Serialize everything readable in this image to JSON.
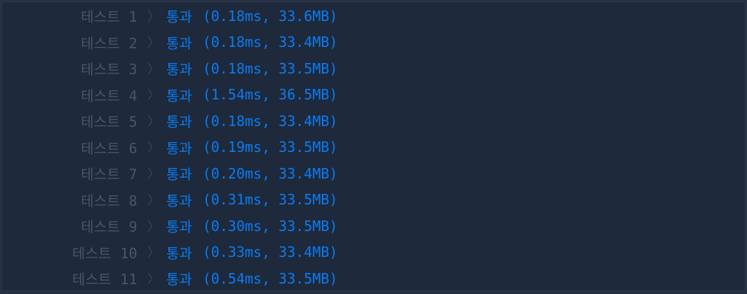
{
  "results": [
    {
      "label": "테스트 1",
      "status": "통과",
      "metrics": "(0.18ms, 33.6MB)"
    },
    {
      "label": "테스트 2",
      "status": "통과",
      "metrics": "(0.18ms, 33.4MB)"
    },
    {
      "label": "테스트 3",
      "status": "통과",
      "metrics": "(0.18ms, 33.5MB)"
    },
    {
      "label": "테스트 4",
      "status": "통과",
      "metrics": "(1.54ms, 36.5MB)"
    },
    {
      "label": "테스트 5",
      "status": "통과",
      "metrics": "(0.18ms, 33.4MB)"
    },
    {
      "label": "테스트 6",
      "status": "통과",
      "metrics": "(0.19ms, 33.5MB)"
    },
    {
      "label": "테스트 7",
      "status": "통과",
      "metrics": "(0.20ms, 33.4MB)"
    },
    {
      "label": "테스트 8",
      "status": "통과",
      "metrics": "(0.31ms, 33.5MB)"
    },
    {
      "label": "테스트 9",
      "status": "통과",
      "metrics": "(0.30ms, 33.5MB)"
    },
    {
      "label": "테스트 10",
      "status": "통과",
      "metrics": "(0.33ms, 33.4MB)"
    },
    {
      "label": "테스트 11",
      "status": "통과",
      "metrics": "(0.54ms, 33.5MB)"
    }
  ],
  "icons": {
    "row_chevron": "chevron-right-icon"
  },
  "colors": {
    "background": "#1e293b",
    "label": "#4a5668",
    "pass": "#0a7cf3"
  }
}
